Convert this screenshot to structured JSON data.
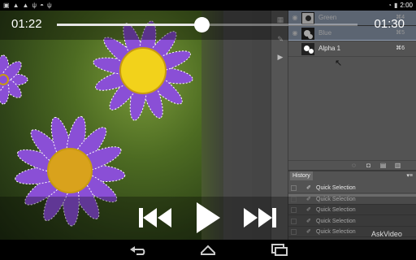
{
  "status_bar": {
    "time": "2:00",
    "left_icons": [
      "image-icon",
      "warning-icon",
      "warning-icon",
      "usb-icon",
      "android-icon",
      "usb-icon"
    ],
    "right_icons": [
      "wifi-icon",
      "battery-icon"
    ]
  },
  "player": {
    "current_time": "01:22",
    "total_time": "01:30",
    "progress": 0.48,
    "watermark": "AskVideo"
  },
  "channels": [
    {
      "name": "Green",
      "shortcut": "⌘4",
      "selected": true
    },
    {
      "name": "Blue",
      "shortcut": "⌘5",
      "selected": true
    },
    {
      "name": "Alpha 1",
      "shortcut": "⌘6",
      "selected": false
    }
  ],
  "history": {
    "tab_label": "History",
    "items": [
      "Quick Selection",
      "Quick Selection",
      "Quick Selection",
      "Quick Selection",
      "Quick Selection",
      "Quick Selection"
    ],
    "active_index": 1
  },
  "colors": {
    "petal": "#8a4fd6",
    "center": "#f2d21b",
    "panel": "#535353",
    "selected_row": "#8e9bb0"
  }
}
